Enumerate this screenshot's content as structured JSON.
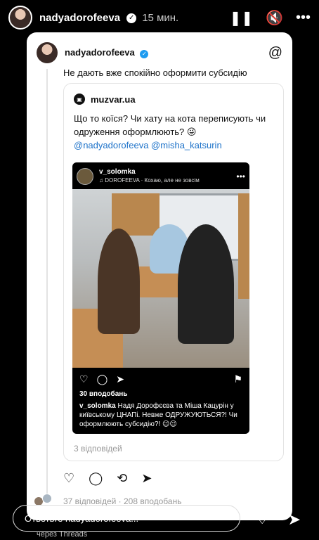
{
  "story": {
    "username": "nadyadorofeeva",
    "time": "15 мин.",
    "icons": {
      "pause": "pause-icon",
      "mute": "mute-icon",
      "more": "more-icon"
    }
  },
  "post": {
    "username": "nadyadorofeeva",
    "text": "Не дають вже спокійно оформити субсидію",
    "quote": {
      "source": "muzvar.ua",
      "text": "Що то коїся? Чи хату на кота переписують чи одруження оформлюють? 😜",
      "mentions": "@nadyadorofeeva @misha_katsurin",
      "instagram": {
        "username": "v_solomka",
        "music": "♫ DOROFEEVA · Кохаю, але не зовсім",
        "likes": "30 вподобань",
        "caption_user": "v_solomka",
        "caption": "Надя Дорофєєва та Міша Кацурін у київському ЦНАПі. Невже ОДРУЖУЮТЬСЯ?! Чи оформлюють субсидію?! 😉😉"
      },
      "replies": "3 відповідей"
    },
    "stats": "37 відповідей · 208 вподобань"
  },
  "reply": {
    "placeholder": "Ответьте nadyadorofeeva...",
    "via": "через Threads"
  },
  "colors": {
    "link": "#1d72c9",
    "verified": "#1d9bf0",
    "background": "#000000",
    "card": "#ffffff"
  }
}
